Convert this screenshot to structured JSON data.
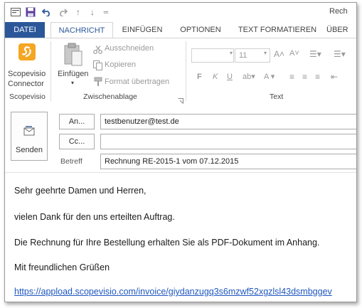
{
  "window": {
    "title_fragment": "Rech"
  },
  "quick_access": {
    "icons": [
      "mail-icon",
      "save-icon",
      "undo-icon",
      "redo-icon",
      "up-arrow-icon",
      "down-arrow-icon",
      "customize-icon"
    ]
  },
  "tabs": [
    "DATEI",
    "NACHRICHT",
    "EINFÜGEN",
    "OPTIONEN",
    "TEXT FORMATIEREN",
    "ÜBER"
  ],
  "active_tab": "NACHRICHT",
  "ribbon": {
    "scopevisio": {
      "btn_line1": "Scopevisio",
      "btn_line2": "Connector",
      "group": "Scopevisio",
      "brand_color": "#f5a623"
    },
    "clipboard": {
      "paste": "Einfügen",
      "cut": "Ausschneiden",
      "copy": "Kopieren",
      "format": "Format übertragen",
      "group": "Zwischenablage"
    },
    "text": {
      "font_size": "11",
      "bold": "F",
      "italic": "K",
      "underline": "U",
      "group": "Text"
    }
  },
  "compose": {
    "send": "Senden",
    "to_button": "An...",
    "to_value": "testbenutzer@test.de",
    "cc_button": "Cc...",
    "cc_value": "",
    "subject_label": "Betreff",
    "subject_value": "Rechnung RE-2015-1 vom 07.12.2015"
  },
  "body": {
    "greeting": "Sehr geehrte Damen und Herren,",
    "line1": "vielen Dank für den uns erteilten Auftrag.",
    "line2": "Die Rechnung für Ihre Bestellung erhalten Sie als PDF-Dokument im Anhang.",
    "closing": "Mit freundlichen Grüßen",
    "link": "https://appload.scopevisio.com/invoice/giydanzugq3s6mzwf52xgzlsl43dsmbggev"
  },
  "colors": {
    "accent": "#2b579a",
    "link": "#1f57c0"
  }
}
